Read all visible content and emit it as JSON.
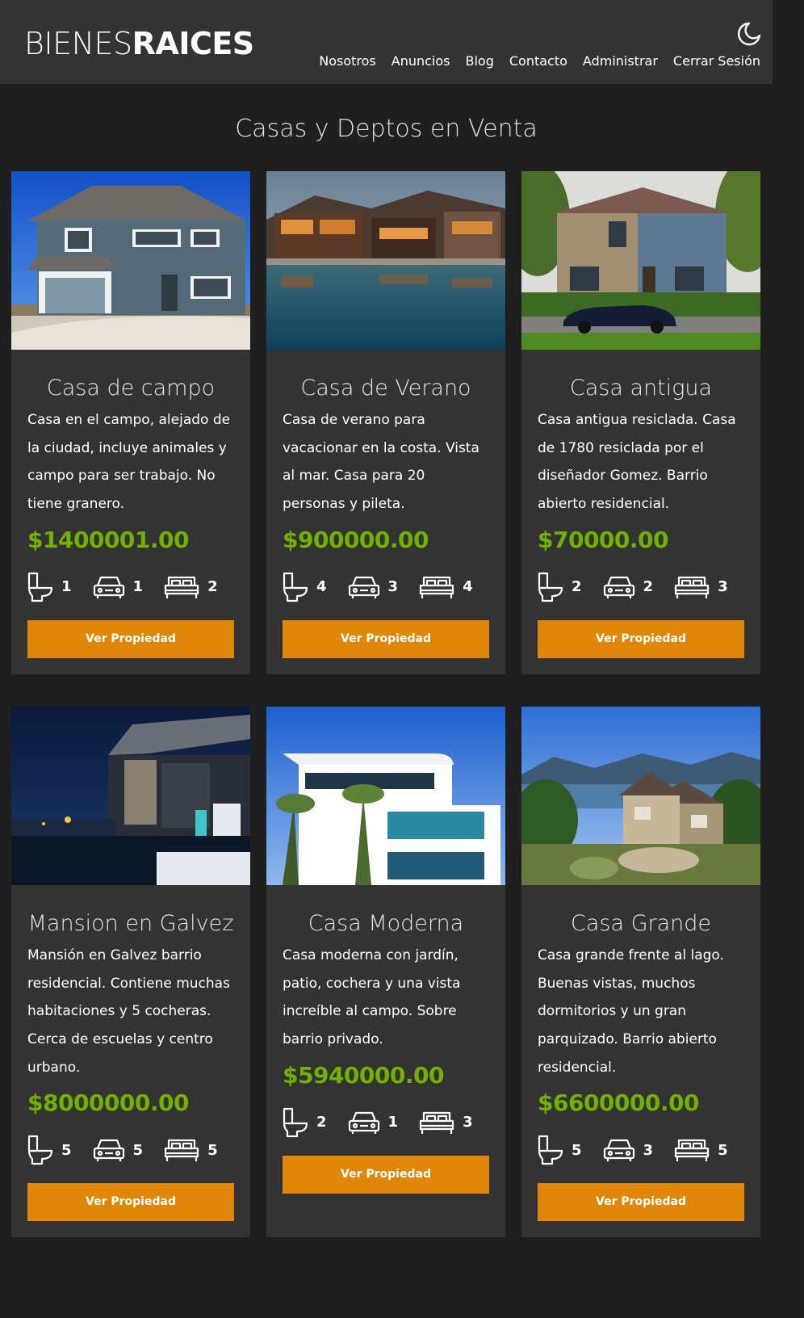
{
  "header": {
    "logo_light": "BIENES",
    "logo_bold": "RAICES",
    "nav": [
      "Nosotros",
      "Anuncios",
      "Blog",
      "Contacto",
      "Administrar",
      "Cerrar Sesión"
    ]
  },
  "main": {
    "title": "Casas y Deptos en Venta",
    "button_label": "Ver Propiedad",
    "listings": [
      {
        "title": "Casa de campo",
        "description": "Casa en el campo, alejado de la ciudad, incluye animales y campo para ser trabajo. No tiene granero.",
        "price": "$1400001.00",
        "baths": "1",
        "parking": "1",
        "bedrooms": "2"
      },
      {
        "title": "Casa de Verano",
        "description": "Casa de verano para vacacionar en la costa. Vista al mar. Casa para 20 personas y pileta.",
        "price": "$900000.00",
        "baths": "4",
        "parking": "3",
        "bedrooms": "4"
      },
      {
        "title": "Casa antigua",
        "description": "Casa antigua resiclada. Casa de 1780 resiclada por el diseñador Gomez. Barrio abierto residencial.",
        "price": "$70000.00",
        "baths": "2",
        "parking": "2",
        "bedrooms": "3"
      },
      {
        "title": "Mansion en Galvez",
        "description": "Mansión en Galvez barrio residencial. Contiene muchas habitaciones y 5 cocheras. Cerca de escuelas y centro urbano.",
        "price": "$8000000.00",
        "baths": "5",
        "parking": "5",
        "bedrooms": "5"
      },
      {
        "title": "Casa Moderna",
        "description": "Casa moderna con jardín, patio, cochera y una vista increíble al campo. Sobre barrio privado.",
        "price": "$5940000.00",
        "baths": "2",
        "parking": "1",
        "bedrooms": "3"
      },
      {
        "title": "Casa Grande",
        "description": "Casa grande frente al lago. Buenas vistas, muchos dormitorios y un gran parquizado. Barrio abierto residencial.",
        "price": "$6600000.00",
        "baths": "5",
        "parking": "3",
        "bedrooms": "5"
      }
    ]
  },
  "icons": {
    "theme_toggle": "moon-icon",
    "baths": "toilet-icon",
    "parking": "car-icon",
    "bedrooms": "bed-icon"
  },
  "colors": {
    "background": "#1f1f1f",
    "surface": "#333333",
    "price": "#71b100",
    "button": "#e08709"
  }
}
